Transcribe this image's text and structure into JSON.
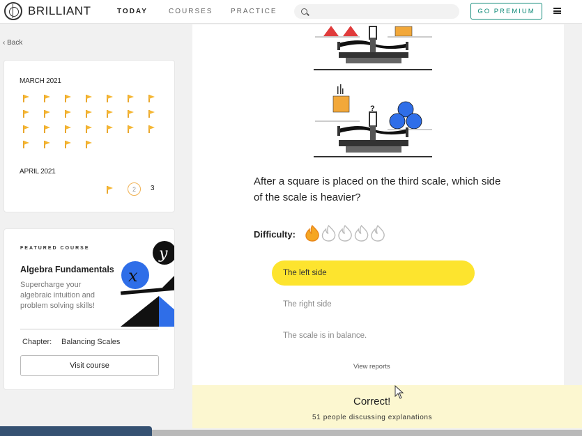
{
  "header": {
    "brand": "BRILLIANT",
    "nav": [
      "TODAY",
      "COURSES",
      "PRACTICE"
    ],
    "active_nav": "TODAY",
    "premium_label": "GO PREMIUM"
  },
  "sidebar": {
    "back_label": "Back",
    "calendar": {
      "month1": "MARCH 2021",
      "month1_flags": 25,
      "month2": "APRIL 2021",
      "month2_days": [
        "2",
        "3"
      ]
    },
    "course": {
      "featured_label": "FEATURED COURSE",
      "title": "Algebra Fundamentals",
      "description": "Supercharge your algebraic intuition and problem solving skills!",
      "chapter_label": "Chapter:",
      "chapter_value": "Balancing Scales",
      "visit_label": "Visit course",
      "art_letters": [
        "x",
        "y"
      ]
    }
  },
  "problem": {
    "scale_question_mark": "?",
    "question": "After a square is placed on the third scale, which side of the scale is heavier?",
    "difficulty_label": "Difficulty:",
    "difficulty_level": 1,
    "difficulty_max": 5,
    "options": [
      "The left side",
      "The right side",
      "The scale is in balance."
    ],
    "selected_option": 0,
    "view_reports_label": "View reports"
  },
  "result": {
    "status": "Correct!",
    "discussion": "51 people discussing explanations"
  },
  "colors": {
    "accent_teal": "#0e8a78",
    "flag_orange": "#f5b632",
    "selected_yellow": "#fde42e",
    "correct_bg": "#fcf7d0",
    "ball_blue": "#2f6ee8",
    "triangle_red": "#e03b3b"
  }
}
